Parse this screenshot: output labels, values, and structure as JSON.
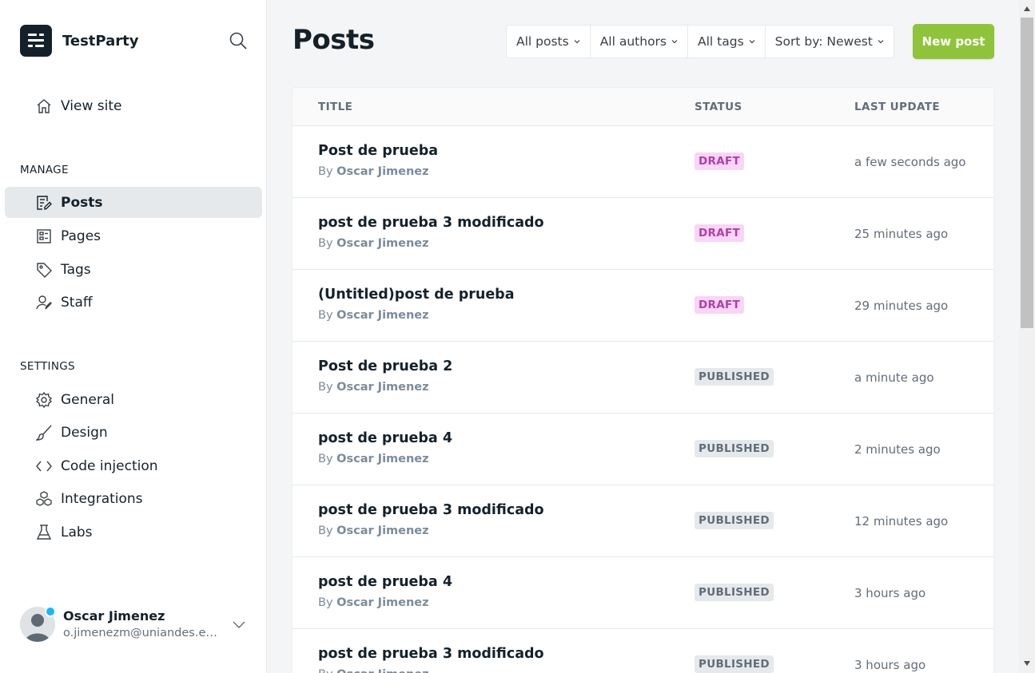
{
  "brand": {
    "name": "TestParty"
  },
  "sidebar": {
    "view_site": "View site",
    "manage_heading": "MANAGE",
    "manage_items": [
      {
        "label": "Posts",
        "icon": "posts-icon",
        "active": true
      },
      {
        "label": "Pages",
        "icon": "pages-icon"
      },
      {
        "label": "Tags",
        "icon": "tag-icon"
      },
      {
        "label": "Staff",
        "icon": "staff-icon"
      }
    ],
    "settings_heading": "SETTINGS",
    "settings_items": [
      {
        "label": "General",
        "icon": "gear-icon"
      },
      {
        "label": "Design",
        "icon": "brush-icon"
      },
      {
        "label": "Code injection",
        "icon": "code-icon"
      },
      {
        "label": "Integrations",
        "icon": "integrations-icon"
      },
      {
        "label": "Labs",
        "icon": "flask-icon"
      }
    ]
  },
  "user": {
    "name": "Oscar Jimenez",
    "email": "o.jimenezm@uniandes.ed..."
  },
  "header": {
    "title": "Posts",
    "filters": [
      "All posts",
      "All authors",
      "All tags",
      "Sort by: Newest"
    ],
    "new_post": "New post"
  },
  "table": {
    "columns": [
      "TITLE",
      "STATUS",
      "LAST UPDATE"
    ],
    "rows": [
      {
        "title": "Post de prueba",
        "by": "By",
        "author": "Oscar Jimenez",
        "status": "DRAFT",
        "updated": "a few seconds ago"
      },
      {
        "title": "post de prueba 3 modificado",
        "by": "By",
        "author": "Oscar Jimenez",
        "status": "DRAFT",
        "updated": "25 minutes ago"
      },
      {
        "title": "(Untitled)post de prueba",
        "by": "By",
        "author": "Oscar Jimenez",
        "status": "DRAFT",
        "updated": "29 minutes ago"
      },
      {
        "title": "Post de prueba 2",
        "by": "By",
        "author": "Oscar Jimenez",
        "status": "PUBLISHED",
        "updated": "a minute ago"
      },
      {
        "title": "post de prueba 4",
        "by": "By",
        "author": "Oscar Jimenez",
        "status": "PUBLISHED",
        "updated": "2 minutes ago"
      },
      {
        "title": "post de prueba 3 modificado",
        "by": "By",
        "author": "Oscar Jimenez",
        "status": "PUBLISHED",
        "updated": "12 minutes ago"
      },
      {
        "title": "post de prueba 4",
        "by": "By",
        "author": "Oscar Jimenez",
        "status": "PUBLISHED",
        "updated": "3 hours ago"
      },
      {
        "title": "post de prueba 3 modificado",
        "by": "By",
        "author": "Oscar Jimenez",
        "status": "PUBLISHED",
        "updated": "3 hours ago"
      }
    ]
  },
  "colors": {
    "accent_green": "#8fc43a",
    "draft_bg": "#f8d6f5",
    "draft_text": "#b23cab",
    "published_bg": "#e6e9eb",
    "published_text": "#626d79",
    "notification_dot": "#14b8ff"
  }
}
